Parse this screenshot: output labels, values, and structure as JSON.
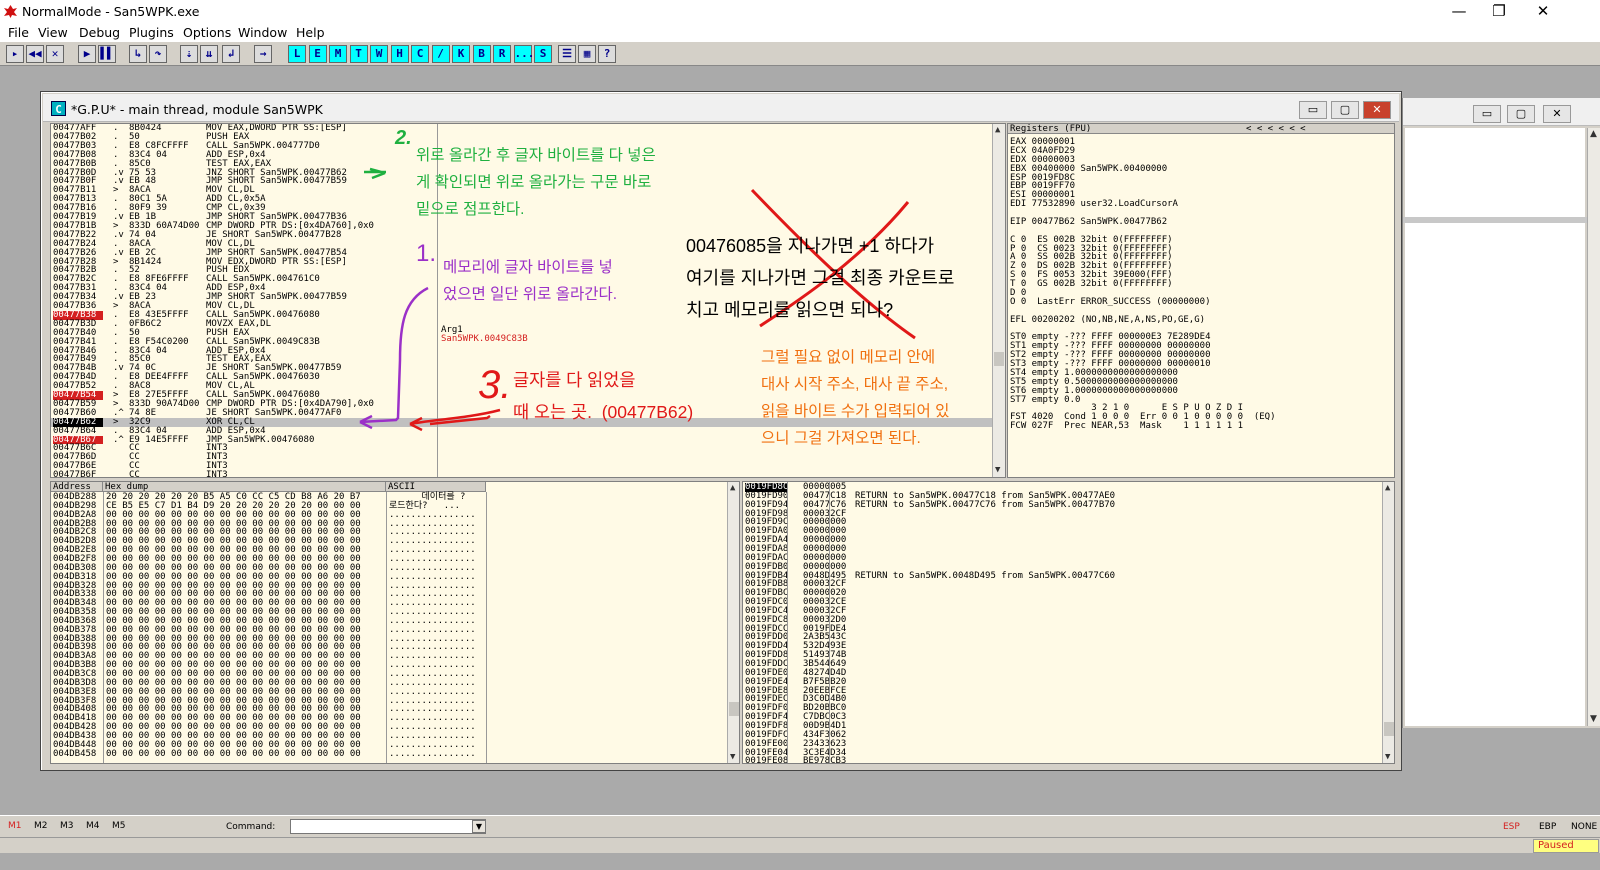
{
  "title": "NormalMode - San5WPK.exe",
  "window_controls": {
    "minimize": "—",
    "restore": "❐",
    "close": "✕"
  },
  "menu": [
    "File",
    "View",
    "Debug",
    "Plugins",
    "Options",
    "Window",
    "Help"
  ],
  "toolbar": {
    "icons": [
      {
        "label": "▸",
        "name": "open-icon"
      },
      {
        "label": "◀◀",
        "name": "rewind-icon"
      },
      {
        "label": "✕",
        "name": "close-program-icon"
      },
      {
        "label": "▶",
        "name": "run-icon"
      },
      {
        "label": "▌▌",
        "name": "pause-icon"
      },
      {
        "label": "↳",
        "name": "step-into-icon"
      },
      {
        "label": "↷",
        "name": "step-over-icon"
      },
      {
        "label": "⇣",
        "name": "trace-into-icon"
      },
      {
        "label": "⇊",
        "name": "trace-over-icon"
      },
      {
        "label": "↲",
        "name": "execute-till-return-icon"
      },
      {
        "label": "→",
        "name": "goto-icon"
      }
    ],
    "letters": [
      "L",
      "E",
      "M",
      "T",
      "W",
      "H",
      "C",
      "/",
      "K",
      "B",
      "R",
      "...",
      "S"
    ],
    "extra_icons": [
      {
        "label": "☰",
        "name": "list-icon"
      },
      {
        "label": "▦",
        "name": "grid-icon"
      },
      {
        "label": "?",
        "name": "help-icon"
      }
    ]
  },
  "cpu_window": {
    "title": "*G.P.U* - main thread, module San5WPK",
    "icon_letter": "C"
  },
  "disasm": [
    {
      "addr": "00477AFF",
      "j": ".",
      "hex": "8B0424",
      "asm": "MOV EAX,DWORD PTR SS:[ESP]"
    },
    {
      "addr": "00477B02",
      "j": ".",
      "hex": "50",
      "asm": "PUSH EAX"
    },
    {
      "addr": "00477B03",
      "j": ".",
      "hex": "E8 C8FCFFFF",
      "asm": "CALL San5WPK.004777D0"
    },
    {
      "addr": "00477B08",
      "j": ".",
      "hex": "83C4 04",
      "asm": "ADD ESP,0x4"
    },
    {
      "addr": "00477B0B",
      "j": ".",
      "hex": "85C0",
      "asm": "TEST EAX,EAX"
    },
    {
      "addr": "00477B0D",
      "j": ".v",
      "hex": "75 53",
      "asm": "JNZ SHORT San5WPK.00477B62"
    },
    {
      "addr": "00477B0F",
      "j": ".v",
      "hex": "EB 48",
      "asm": "JMP SHORT San5WPK.00477B59"
    },
    {
      "addr": "00477B11",
      "j": ">",
      "hex": "8ACA",
      "asm": "MOV CL,DL"
    },
    {
      "addr": "00477B13",
      "j": ".",
      "hex": "80C1 5A",
      "asm": "ADD CL,0x5A"
    },
    {
      "addr": "00477B16",
      "j": ".",
      "hex": "80F9 39",
      "asm": "CMP CL,0x39"
    },
    {
      "addr": "00477B19",
      "j": ".v",
      "hex": "EB 1B",
      "asm": "JMP SHORT San5WPK.00477B36"
    },
    {
      "addr": "00477B1B",
      "j": ">",
      "hex": "833D 60A74D00",
      "asm": "CMP DWORD PTR DS:[0x4DA760],0x0"
    },
    {
      "addr": "00477B22",
      "j": ".v",
      "hex": "74 04",
      "asm": "JE SHORT San5WPK.00477B28"
    },
    {
      "addr": "00477B24",
      "j": ".",
      "hex": "8ACA",
      "asm": "MOV CL,DL"
    },
    {
      "addr": "00477B26",
      "j": ".v",
      "hex": "EB 2C",
      "asm": "JMP SHORT San5WPK.00477B54"
    },
    {
      "addr": "00477B28",
      "j": ">",
      "hex": "8B1424",
      "asm": "MOV EDX,DWORD PTR SS:[ESP]"
    },
    {
      "addr": "00477B2B",
      "j": ".",
      "hex": "52",
      "asm": "PUSH EDX"
    },
    {
      "addr": "00477B2C",
      "j": ".",
      "hex": "E8 8FE6FFFF",
      "asm": "CALL San5WPK.004761C0"
    },
    {
      "addr": "00477B31",
      "j": ".",
      "hex": "83C4 04",
      "asm": "ADD ESP,0x4"
    },
    {
      "addr": "00477B34",
      "j": ".v",
      "hex": "EB 23",
      "asm": "JMP SHORT San5WPK.00477B59"
    },
    {
      "addr": "00477B36",
      "j": ">",
      "hex": "8ACA",
      "asm": "MOV CL,DL"
    },
    {
      "addr": "00477B38",
      "j": ".",
      "hex": "E8 43E5FFFF",
      "asm": "CALL San5WPK.00476080",
      "bp": true
    },
    {
      "addr": "00477B3D",
      "j": ".",
      "hex": "0FB6C2",
      "asm": "MOVZX EAX,DL"
    },
    {
      "addr": "00477B40",
      "j": ".",
      "hex": "50",
      "asm": "PUSH EAX"
    },
    {
      "addr": "00477B41",
      "j": ".",
      "hex": "E8 F54C0200",
      "asm": "CALL San5WPK.0049C83B"
    },
    {
      "addr": "00477B46",
      "j": ".",
      "hex": "83C4 04",
      "asm": "ADD ESP,0x4"
    },
    {
      "addr": "00477B49",
      "j": ".",
      "hex": "85C0",
      "asm": "TEST EAX,EAX"
    },
    {
      "addr": "00477B4B",
      "j": ".v",
      "hex": "74 0C",
      "asm": "JE SHORT San5WPK.00477B59"
    },
    {
      "addr": "00477B4D",
      "j": ".",
      "hex": "E8 DEE4FFFF",
      "asm": "CALL San5WPK.00476030"
    },
    {
      "addr": "00477B52",
      "j": ".",
      "hex": "8AC8",
      "asm": "MOV CL,AL"
    },
    {
      "addr": "00477B54",
      "j": ">",
      "hex": "E8 27E5FFFF",
      "asm": "CALL San5WPK.00476080",
      "bp": true
    },
    {
      "addr": "00477B59",
      "j": ">",
      "hex": "833D 90A74D00",
      "asm": "CMP DWORD PTR DS:[0x4DA790],0x0"
    },
    {
      "addr": "00477B60",
      "j": ".^",
      "hex": "74 8E",
      "asm": "JE SHORT San5WPK.00477AF0"
    },
    {
      "addr": "00477B62",
      "j": ">",
      "hex": "32C9",
      "asm": "XOR CL,CL",
      "cur": true
    },
    {
      "addr": "00477B64",
      "j": ".",
      "hex": "83C4 04",
      "asm": "ADD ESP,0x4"
    },
    {
      "addr": "00477B67",
      "j": ".^",
      "hex": "E9 14E5FFFF",
      "asm": "JMP San5WPK.00476080",
      "bp": true
    },
    {
      "addr": "00477B6C",
      "j": "",
      "hex": "CC",
      "asm": "INT3"
    },
    {
      "addr": "00477B6D",
      "j": "",
      "hex": "CC",
      "asm": "INT3"
    },
    {
      "addr": "00477B6E",
      "j": "",
      "hex": "CC",
      "asm": "INT3"
    },
    {
      "addr": "00477B6F",
      "j": "",
      "hex": "CC",
      "asm": "INT3"
    }
  ],
  "arg": {
    "label": "Arg1",
    "value": "San5WPK.0049C83B"
  },
  "registers": {
    "header": "Registers (FPU)",
    "header_arrows": "<      <      <      <      <      <",
    "lines": [
      "EAX 00000001",
      "ECX 04A0FD29",
      "EDX 00000003",
      "EBX 00400000 San5WPK.00400000",
      "ESP 0019FD8C",
      "EBP 0019FF70",
      "ESI 00000001",
      "EDI 77532890 user32.LoadCursorA",
      "",
      "EIP 00477B62 San5WPK.00477B62",
      "",
      "C 0  ES 002B 32bit 0(FFFFFFFF)",
      "P 0  CS 0023 32bit 0(FFFFFFFF)",
      "A 0  SS 002B 32bit 0(FFFFFFFF)",
      "Z 0  DS 002B 32bit 0(FFFFFFFF)",
      "S 0  FS 0053 32bit 39E000(FFF)",
      "T 0  GS 002B 32bit 0(FFFFFFFF)",
      "D 0",
      "O 0  LastErr ERROR_SUCCESS (00000000)",
      "",
      "EFL 00200202 (NO,NB,NE,A,NS,PO,GE,G)",
      "",
      "ST0 empty -??? FFFF 000000E3 7E289DE4",
      "ST1 empty -??? FFFF 00000000 00000000",
      "ST2 empty -??? FFFF 00000000 00000000",
      "ST3 empty -??? FFFF 00000000 00000010",
      "ST4 empty 1.0000000000000000000",
      "ST5 empty 0.5000000000000000000",
      "ST6 empty 1.0000000000000000000",
      "ST7 empty 0.0",
      "               3 2 1 0      E S P U O Z D I",
      "FST 4020  Cond 1 0 0 0  Err 0 0 1 0 0 0 0 0  (EQ)",
      "FCW 027F  Prec NEAR,53  Mask    1 1 1 1 1 1"
    ]
  },
  "dump": {
    "h_address": "Address",
    "h_hex": "Hex dump",
    "h_ascii": "ASCII",
    "rows": [
      {
        "addr": "004DB288",
        "hex": "20 20 20 20 20 20 B5 A5 C0 CC C5 CD B8 A6 20 B7",
        "ascii": "      데이터를 ?"
      },
      {
        "addr": "004DB298",
        "hex": "CE B5 E5 C7 D1 B4 D9 20 20 20 20 20 20 00 00 00",
        "ascii": "로드한다?   ..."
      },
      {
        "addr": "004DB2A8",
        "hex": "00 00 00 00 00 00 00 00 00 00 00 00 00 00 00 00",
        "ascii": "................"
      },
      {
        "addr": "004DB2B8",
        "hex": "00 00 00 00 00 00 00 00 00 00 00 00 00 00 00 00",
        "ascii": "................"
      },
      {
        "addr": "004DB2C8",
        "hex": "00 00 00 00 00 00 00 00 00 00 00 00 00 00 00 00",
        "ascii": "................"
      },
      {
        "addr": "004DB2D8",
        "hex": "00 00 00 00 00 00 00 00 00 00 00 00 00 00 00 00",
        "ascii": "................"
      },
      {
        "addr": "004DB2E8",
        "hex": "00 00 00 00 00 00 00 00 00 00 00 00 00 00 00 00",
        "ascii": "................"
      },
      {
        "addr": "004DB2F8",
        "hex": "00 00 00 00 00 00 00 00 00 00 00 00 00 00 00 00",
        "ascii": "................"
      },
      {
        "addr": "004DB308",
        "hex": "00 00 00 00 00 00 00 00 00 00 00 00 00 00 00 00",
        "ascii": "................"
      },
      {
        "addr": "004DB318",
        "hex": "00 00 00 00 00 00 00 00 00 00 00 00 00 00 00 00",
        "ascii": "................"
      },
      {
        "addr": "004DB328",
        "hex": "00 00 00 00 00 00 00 00 00 00 00 00 00 00 00 00",
        "ascii": "................"
      },
      {
        "addr": "004DB338",
        "hex": "00 00 00 00 00 00 00 00 00 00 00 00 00 00 00 00",
        "ascii": "................"
      },
      {
        "addr": "004DB348",
        "hex": "00 00 00 00 00 00 00 00 00 00 00 00 00 00 00 00",
        "ascii": "................"
      },
      {
        "addr": "004DB358",
        "hex": "00 00 00 00 00 00 00 00 00 00 00 00 00 00 00 00",
        "ascii": "................"
      },
      {
        "addr": "004DB368",
        "hex": "00 00 00 00 00 00 00 00 00 00 00 00 00 00 00 00",
        "ascii": "................"
      },
      {
        "addr": "004DB378",
        "hex": "00 00 00 00 00 00 00 00 00 00 00 00 00 00 00 00",
        "ascii": "................"
      },
      {
        "addr": "004DB388",
        "hex": "00 00 00 00 00 00 00 00 00 00 00 00 00 00 00 00",
        "ascii": "................"
      },
      {
        "addr": "004DB398",
        "hex": "00 00 00 00 00 00 00 00 00 00 00 00 00 00 00 00",
        "ascii": "................"
      },
      {
        "addr": "004DB3A8",
        "hex": "00 00 00 00 00 00 00 00 00 00 00 00 00 00 00 00",
        "ascii": "................"
      },
      {
        "addr": "004DB3B8",
        "hex": "00 00 00 00 00 00 00 00 00 00 00 00 00 00 00 00",
        "ascii": "................"
      },
      {
        "addr": "004DB3C8",
        "hex": "00 00 00 00 00 00 00 00 00 00 00 00 00 00 00 00",
        "ascii": "................"
      },
      {
        "addr": "004DB3D8",
        "hex": "00 00 00 00 00 00 00 00 00 00 00 00 00 00 00 00",
        "ascii": "................"
      },
      {
        "addr": "004DB3E8",
        "hex": "00 00 00 00 00 00 00 00 00 00 00 00 00 00 00 00",
        "ascii": "................"
      },
      {
        "addr": "004DB3F8",
        "hex": "00 00 00 00 00 00 00 00 00 00 00 00 00 00 00 00",
        "ascii": "................"
      },
      {
        "addr": "004DB408",
        "hex": "00 00 00 00 00 00 00 00 00 00 00 00 00 00 00 00",
        "ascii": "................"
      },
      {
        "addr": "004DB418",
        "hex": "00 00 00 00 00 00 00 00 00 00 00 00 00 00 00 00",
        "ascii": "................"
      },
      {
        "addr": "004DB428",
        "hex": "00 00 00 00 00 00 00 00 00 00 00 00 00 00 00 00",
        "ascii": "................"
      },
      {
        "addr": "004DB438",
        "hex": "00 00 00 00 00 00 00 00 00 00 00 00 00 00 00 00",
        "ascii": "................"
      },
      {
        "addr": "004DB448",
        "hex": "00 00 00 00 00 00 00 00 00 00 00 00 00 00 00 00",
        "ascii": "................"
      },
      {
        "addr": "004DB458",
        "hex": "00 00 00 00 00 00 00 00 00 00 00 00 00 00 00 00",
        "ascii": "................"
      }
    ]
  },
  "stack": {
    "rows": [
      {
        "addr": "0019FD8C",
        "val": "00000005",
        "cmt": "",
        "sel": true
      },
      {
        "addr": "0019FD90",
        "val": "00477C18",
        "cmt": "RETURN to San5WPK.00477C18 from San5WPK.00477AE0"
      },
      {
        "addr": "0019FD94",
        "val": "00477C76",
        "cmt": "RETURN to San5WPK.00477C76 from San5WPK.00477B70"
      },
      {
        "addr": "0019FD98",
        "val": "000032CF",
        "cmt": ""
      },
      {
        "addr": "0019FD9C",
        "val": "00000000",
        "cmt": ""
      },
      {
        "addr": "0019FDA0",
        "val": "00000000",
        "cmt": ""
      },
      {
        "addr": "0019FDA4",
        "val": "00000000",
        "cmt": ""
      },
      {
        "addr": "0019FDA8",
        "val": "00000000",
        "cmt": ""
      },
      {
        "addr": "0019FDAC",
        "val": "00000000",
        "cmt": ""
      },
      {
        "addr": "0019FDB0",
        "val": "00000000",
        "cmt": ""
      },
      {
        "addr": "0019FDB4",
        "val": "0048D495",
        "cmt": "RETURN to San5WPK.0048D495 from San5WPK.00477C60"
      },
      {
        "addr": "0019FDB8",
        "val": "000032CF",
        "cmt": ""
      },
      {
        "addr": "0019FDBC",
        "val": "00000020",
        "cmt": ""
      },
      {
        "addr": "0019FDC0",
        "val": "000032CE",
        "cmt": ""
      },
      {
        "addr": "0019FDC4",
        "val": "000032CF",
        "cmt": ""
      },
      {
        "addr": "0019FDC8",
        "val": "000032D0",
        "cmt": ""
      },
      {
        "addr": "0019FDCC",
        "val": "0019FDE4",
        "cmt": ""
      },
      {
        "addr": "0019FDD0",
        "val": "2A3B543C",
        "cmt": ""
      },
      {
        "addr": "0019FDD4",
        "val": "532D493E",
        "cmt": ""
      },
      {
        "addr": "0019FDD8",
        "val": "5149374B",
        "cmt": ""
      },
      {
        "addr": "0019FDDC",
        "val": "3B544649",
        "cmt": ""
      },
      {
        "addr": "0019FDE0",
        "val": "48274D4D",
        "cmt": ""
      },
      {
        "addr": "0019FDE4",
        "val": "B7F5BB20",
        "cmt": ""
      },
      {
        "addr": "0019FDE8",
        "val": "20EEBFCE",
        "cmt": ""
      },
      {
        "addr": "0019FDEC",
        "val": "D3C0D4B0",
        "cmt": ""
      },
      {
        "addr": "0019FDF0",
        "val": "BD20BBC0",
        "cmt": ""
      },
      {
        "addr": "0019FDF4",
        "val": "C7DBC0C3",
        "cmt": ""
      },
      {
        "addr": "0019FDF8",
        "val": "00D9B4D1",
        "cmt": ""
      },
      {
        "addr": "0019FDFC",
        "val": "434F3062",
        "cmt": ""
      },
      {
        "addr": "0019FE00",
        "val": "23433623",
        "cmt": ""
      },
      {
        "addr": "0019FE04",
        "val": "3C3E4D34",
        "cmt": ""
      },
      {
        "addr": "0019FE08",
        "val": "BE978CB3",
        "cmt": ""
      }
    ]
  },
  "annotations": {
    "n2_num": "2.",
    "n2_text": "위로 올라간 후 글자 바이트를 다 넣은\n게 확인되면 위로 올라가는 구문 바로\n밑으로 점프한다.",
    "n1_num": "1.",
    "n1_text": "메모리에 글자 바이트를 넣\n었으면 일단 위로 올라간다.",
    "n3_num": "3.",
    "n3_text": "글자를 다 읽었을\n때 오는 곳.  (00477B62)",
    "black_text": "00476085을 지나가면 +1 하다가\n여기를 지나가면 그걸 최종 카운트로\n치고 메모리를 읽으면 되나?",
    "orange_text": "그럴 필요 없이 메모리 안에\n대사 시작 주소, 대사 끝 주소,\n읽을 바이트 수가 입력되어 있\n으니 그걸 가져오면 된다."
  },
  "bottom": {
    "markers": [
      "M1",
      "M2",
      "M3",
      "M4",
      "M5"
    ],
    "command_label": "Command:",
    "command_value": "",
    "esp": "ESP",
    "ebp": "EBP",
    "none": "NONE"
  },
  "status": "Paused",
  "colors": {
    "pane_bg": "#fffae6",
    "breakpoint": "#d42020",
    "current": "#c0c0c0",
    "note_green": "#1fb040",
    "note_purple": "#9b30c8",
    "note_red": "#e01818",
    "note_orange": "#f07010"
  }
}
